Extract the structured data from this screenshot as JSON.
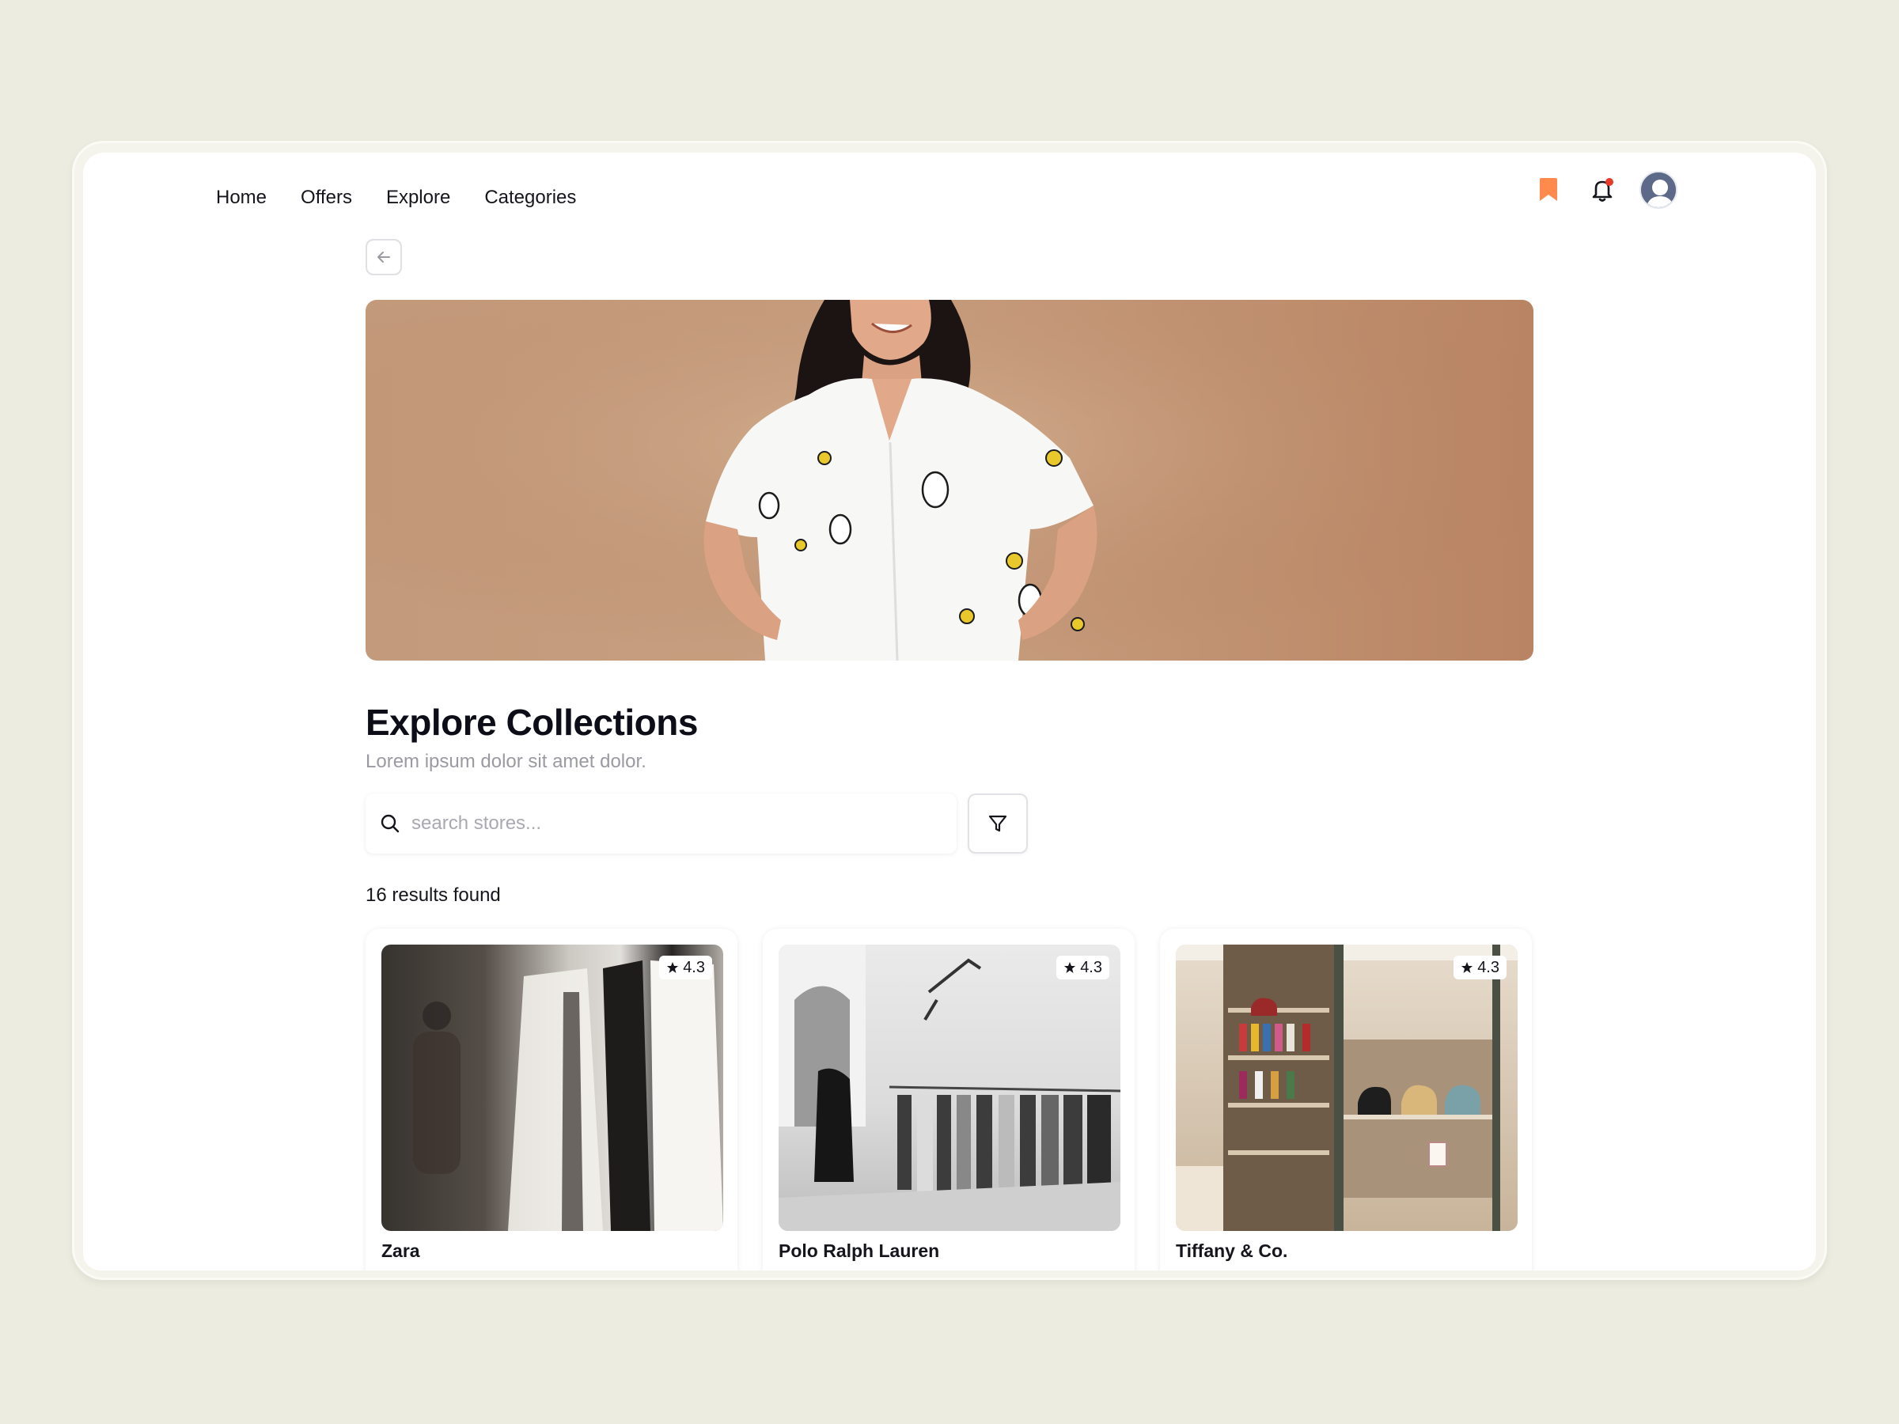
{
  "nav": {
    "items": [
      "Home",
      "Offers",
      "Explore",
      "Categories"
    ]
  },
  "icons": {
    "bookmark": "bookmark-icon",
    "bell": "bell-icon",
    "avatar": "user-avatar",
    "back": "arrow-left-icon",
    "search": "search-icon",
    "filter": "filter-icon",
    "star": "star-icon"
  },
  "colors": {
    "accent": "#ff8a4c",
    "notification_dot": "#e8392b",
    "background": "#ecece0"
  },
  "main": {
    "title": "Explore Collections",
    "subtitle": "Lorem ipsum dolor sit amet dolor."
  },
  "search": {
    "placeholder": "search stores...",
    "value": ""
  },
  "results": {
    "label": "16 results found"
  },
  "stores": [
    {
      "name": "Zara",
      "rating": "4.3"
    },
    {
      "name": "Polo Ralph Lauren",
      "rating": "4.3"
    },
    {
      "name": "Tiffany & Co.",
      "rating": "4.3"
    }
  ]
}
